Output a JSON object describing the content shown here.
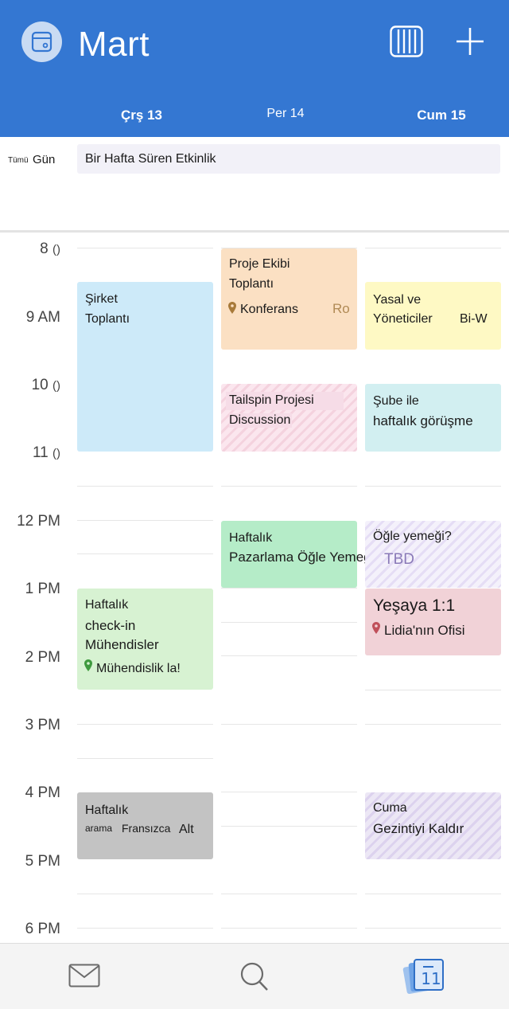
{
  "header": {
    "month": "Mart",
    "days": [
      {
        "label": "Çrş 13",
        "bold": true
      },
      {
        "label": "Per 14",
        "bold": false
      },
      {
        "label": "Cum 15",
        "bold": true
      }
    ]
  },
  "all_day": {
    "label_small": "Tümü",
    "label": "Gün",
    "event": "Bir Hafta Süren Etkinlik"
  },
  "hours": [
    {
      "h": "8",
      "suffix": "()"
    },
    {
      "h": "9 AM",
      "suffix": ""
    },
    {
      "h": "10",
      "suffix": "()"
    },
    {
      "h": "11",
      "suffix": "()"
    },
    {
      "h": "12 PM",
      "suffix": ""
    },
    {
      "h": "1 PM",
      "suffix": ""
    },
    {
      "h": "2 PM",
      "suffix": ""
    },
    {
      "h": "3 PM",
      "suffix": ""
    },
    {
      "h": "4 PM",
      "suffix": ""
    },
    {
      "h": "5 PM",
      "suffix": ""
    },
    {
      "h": "6 PM",
      "suffix": ""
    }
  ],
  "events": {
    "sirket": {
      "line1": "Şirket",
      "line2": "Toplantı"
    },
    "proje": {
      "line1": "Proje Ekibi",
      "line2": "Toplantı",
      "location": "Konferans",
      "room": "Ro"
    },
    "yasal": {
      "line1": "Yasal ve",
      "line2": "Yöneticiler",
      "extra": "Bi-W"
    },
    "tailspin": {
      "line1": "Tailspin Projesi",
      "line2": "Discussion"
    },
    "sube": {
      "line1": "Şube ile",
      "line2": "haftalık görüşme"
    },
    "pazarlama": {
      "line1": "Haftalık",
      "line2": "Pazarlama Öğle Yemeği"
    },
    "ogle": {
      "line1": "Öğle yemeği?",
      "line2": "TBD"
    },
    "checkin": {
      "line1": "Haftalık",
      "line2": "check-in",
      "line3": "Mühendisler",
      "location": "Mühendislik la!"
    },
    "yesaya": {
      "line1": "Yeşaya 1:1",
      "location": "Lidia'nın Ofisi"
    },
    "fransizca": {
      "line1": "Haftalık",
      "line2a": "arama",
      "line2b": "Fransızca",
      "line2c": "Alt"
    },
    "cuma": {
      "line1": "Cuma",
      "line2": "Gezintiyi Kaldır"
    }
  },
  "nav": {
    "calendar_day": "11"
  },
  "colors": {
    "header": "#3477d2",
    "blue_event": "#cdeaf9",
    "orange_event": "#fbe0c3",
    "yellow_event": "#fef9c4",
    "teal_event": "#d2eff1",
    "green_event": "#b5ecc8",
    "light_green_event": "#d7f2d2",
    "red_event": "#f1d2d7",
    "gray_event": "#c3c3c3"
  }
}
